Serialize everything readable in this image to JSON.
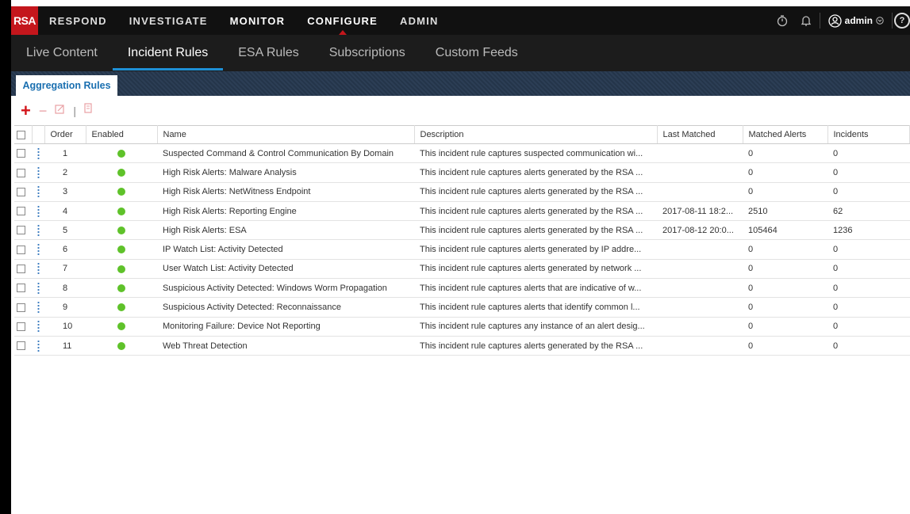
{
  "brand": {
    "logo": "RSA"
  },
  "nav": {
    "items": [
      {
        "label": "RESPOND",
        "bright": false,
        "active": false
      },
      {
        "label": "INVESTIGATE",
        "bright": false,
        "active": false
      },
      {
        "label": "MONITOR",
        "bright": true,
        "active": false
      },
      {
        "label": "CONFIGURE",
        "bright": true,
        "active": true
      },
      {
        "label": "ADMIN",
        "bright": false,
        "active": false
      }
    ],
    "user": "admin",
    "help": "?"
  },
  "subnav": {
    "tabs": [
      {
        "label": "Live Content",
        "active": false
      },
      {
        "label": "Incident Rules",
        "active": true
      },
      {
        "label": "ESA Rules",
        "active": false
      },
      {
        "label": "Subscriptions",
        "active": false
      },
      {
        "label": "Custom Feeds",
        "active": false
      }
    ]
  },
  "panel": {
    "tab": "Aggregation Rules"
  },
  "table": {
    "headers": {
      "order": "Order",
      "enabled": "Enabled",
      "name": "Name",
      "description": "Description",
      "last_matched": "Last Matched",
      "matched_alerts": "Matched Alerts",
      "incidents": "Incidents"
    },
    "rows": [
      {
        "order": "1",
        "enabled": true,
        "name": "Suspected Command & Control Communication By Domain",
        "description": "This incident rule captures suspected communication wi...",
        "last_matched": "",
        "matched_alerts": "0",
        "incidents": "0"
      },
      {
        "order": "2",
        "enabled": true,
        "name": "High Risk Alerts: Malware Analysis",
        "description": "This incident rule captures alerts generated by the RSA ...",
        "last_matched": "",
        "matched_alerts": "0",
        "incidents": "0"
      },
      {
        "order": "3",
        "enabled": true,
        "name": "High Risk Alerts: NetWitness Endpoint",
        "description": "This incident rule captures alerts generated by the RSA ...",
        "last_matched": "",
        "matched_alerts": "0",
        "incidents": "0"
      },
      {
        "order": "4",
        "enabled": true,
        "name": "High Risk Alerts: Reporting Engine",
        "description": "This incident rule captures alerts generated by the RSA ...",
        "last_matched": "2017-08-11 18:2...",
        "matched_alerts": "2510",
        "incidents": "62"
      },
      {
        "order": "5",
        "enabled": true,
        "name": "High Risk Alerts: ESA",
        "description": "This incident rule captures alerts generated by the RSA ...",
        "last_matched": "2017-08-12 20:0...",
        "matched_alerts": "105464",
        "incidents": "1236"
      },
      {
        "order": "6",
        "enabled": true,
        "name": "IP Watch List: Activity Detected",
        "description": "This incident rule captures alerts generated by IP addre...",
        "last_matched": "",
        "matched_alerts": "0",
        "incidents": "0"
      },
      {
        "order": "7",
        "enabled": true,
        "name": "User Watch List: Activity Detected",
        "description": "This incident rule captures alerts generated by network ...",
        "last_matched": "",
        "matched_alerts": "0",
        "incidents": "0"
      },
      {
        "order": "8",
        "enabled": true,
        "name": "Suspicious Activity Detected: Windows Worm Propagation",
        "description": "This incident rule captures alerts that are indicative of w...",
        "last_matched": "",
        "matched_alerts": "0",
        "incidents": "0"
      },
      {
        "order": "9",
        "enabled": true,
        "name": "Suspicious Activity Detected: Reconnaissance",
        "description": "This incident rule captures alerts that identify common l...",
        "last_matched": "",
        "matched_alerts": "0",
        "incidents": "0"
      },
      {
        "order": "10",
        "enabled": true,
        "name": "Monitoring Failure: Device Not Reporting",
        "description": "This incident rule captures any instance of an alert desig...",
        "last_matched": "",
        "matched_alerts": "0",
        "incidents": "0"
      },
      {
        "order": "11",
        "enabled": true,
        "name": "Web Threat Detection",
        "description": "This incident rule captures alerts generated by the RSA ...",
        "last_matched": "",
        "matched_alerts": "0",
        "incidents": "0"
      }
    ]
  },
  "colors": {
    "brand_red": "#c4161c",
    "accent_blue": "#1e90d6",
    "enabled_green": "#5fc22a"
  }
}
